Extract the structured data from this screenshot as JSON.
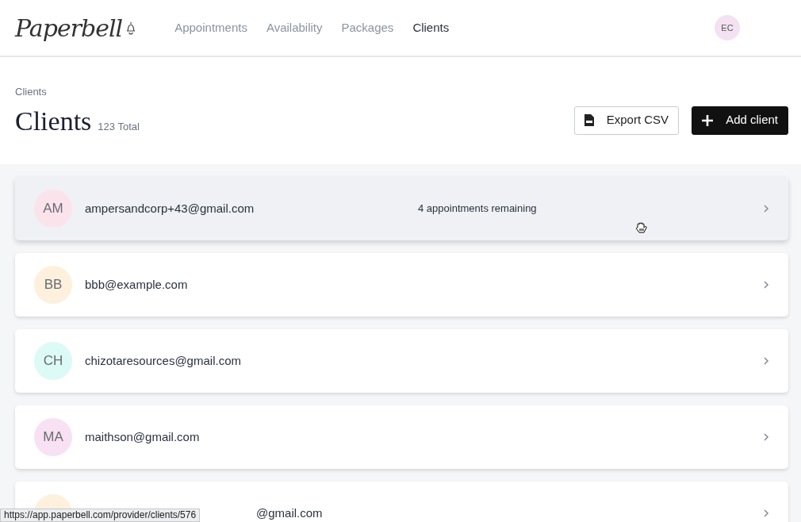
{
  "brand": {
    "name": "Paperbell"
  },
  "nav": [
    {
      "label": "Appointments",
      "selected": false
    },
    {
      "label": "Availability",
      "selected": false
    },
    {
      "label": "Packages",
      "selected": false
    },
    {
      "label": "Clients",
      "selected": true
    }
  ],
  "user": {
    "initials": "EC"
  },
  "breadcrumb": "Clients",
  "title": "Clients",
  "total": "123 Total",
  "buttons": [
    {
      "label": "Export CSV",
      "kind": "export"
    },
    {
      "label": "Add client",
      "kind": "add"
    }
  ],
  "clients": [
    {
      "kind": "full",
      "initials": "AM",
      "email": "ampersandcorp+43@gmail.com",
      "note": "4 appointments remaining",
      "color": "#fbe3ec",
      "hovered": true
    },
    {
      "kind": "full",
      "initials": "BB",
      "email": "bbb@example.com",
      "color": "#fdf0dd",
      "hovered": false
    },
    {
      "kind": "full",
      "initials": "CH",
      "email": "chizotaresources@gmail.com",
      "color": "#dcfaf6",
      "hovered": false
    },
    {
      "kind": "full",
      "initials": "MA",
      "email": "maithson@gmail.com",
      "color": "#f7e1f3",
      "hovered": false
    },
    {
      "kind": "partial",
      "email": "@gmail.com",
      "color": "#fdf0dd",
      "hovered": false
    }
  ],
  "status_url": "https://app.paperbell.com/provider/clients/576"
}
